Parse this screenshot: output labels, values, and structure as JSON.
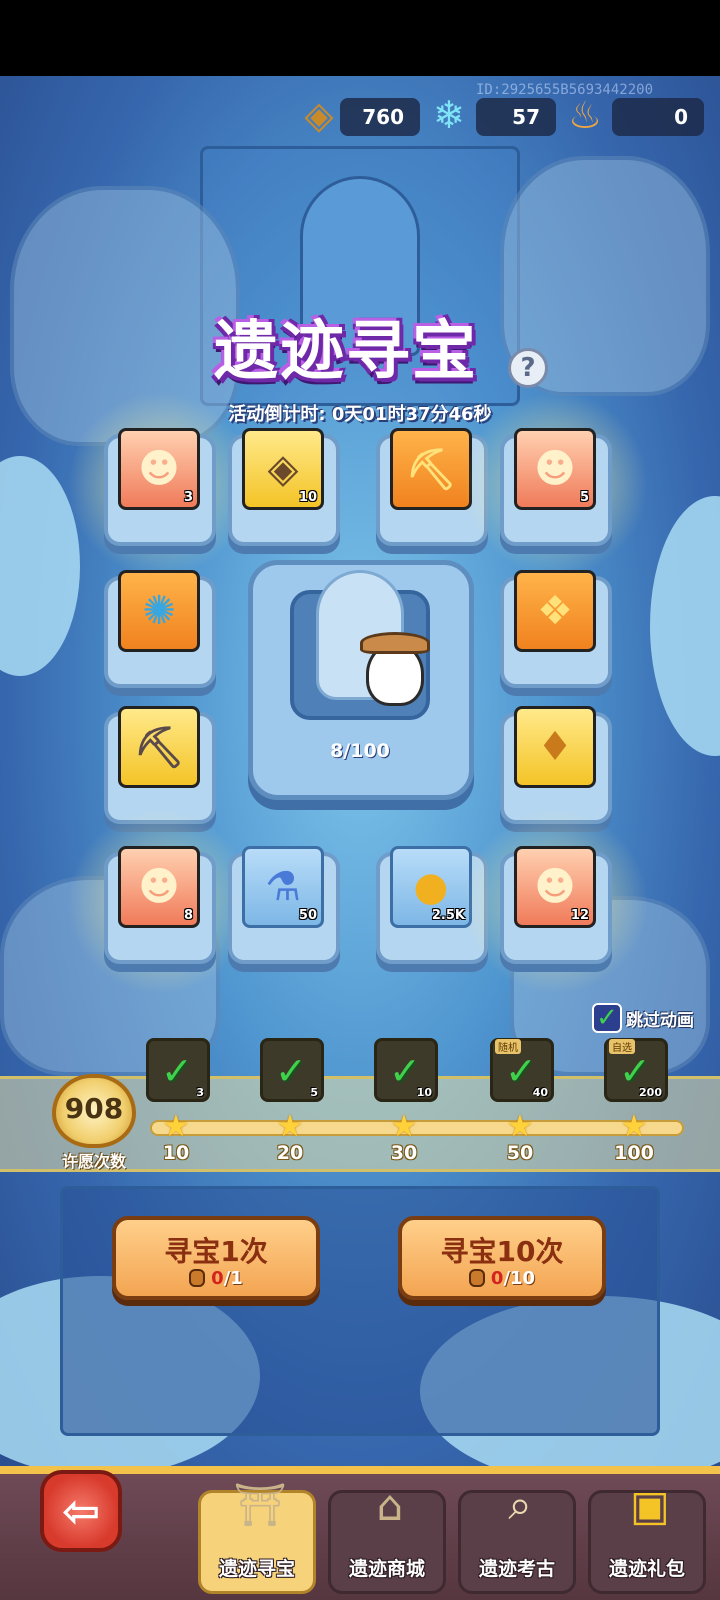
{
  "header": {
    "resources": [
      {
        "name": "rune-stone",
        "icon": "rune-stone-icon",
        "value": "760"
      },
      {
        "name": "crystal",
        "icon": "crystal-plus-icon",
        "value": "57"
      },
      {
        "name": "lantern",
        "icon": "lantern-icon",
        "value": "0"
      }
    ],
    "id_text": "ID:2925655B5693442200"
  },
  "event": {
    "title": "遗迹寻宝",
    "help_icon": "question-mark-icon",
    "countdown": "活动倒计时: 0天01时37分46秒"
  },
  "rewards": [
    {
      "name": "hero-shard",
      "style": "red",
      "icon": "hero-portrait-icon",
      "count": "3",
      "glow": true
    },
    {
      "name": "rune-stone",
      "style": "yellow",
      "icon": "rune-stone-icon",
      "count": "10",
      "glow": false
    },
    {
      "name": "pickaxe-gold",
      "style": "orange",
      "icon": "gold-pickaxe-icon",
      "count": "",
      "glow": false
    },
    {
      "name": "hero-shard",
      "style": "red",
      "icon": "hero-portrait-icon",
      "count": "5",
      "glow": true
    },
    {
      "name": "skill-scroll",
      "style": "orange",
      "icon": "swirl-scroll-icon",
      "count": "",
      "glow": false
    },
    {
      "name": "treasure-pile",
      "style": "orange",
      "icon": "treasure-pile-icon",
      "count": "",
      "glow": false
    },
    {
      "name": "pickaxe-iron",
      "style": "yellow",
      "icon": "iron-pickaxe-icon",
      "count": "",
      "glow": false
    },
    {
      "name": "gold-bag",
      "style": "yellow",
      "icon": "gold-bag-icon",
      "count": "",
      "glow": false
    },
    {
      "name": "hero-shard",
      "style": "red",
      "icon": "hero-portrait-icon",
      "count": "8",
      "glow": true
    },
    {
      "name": "potion",
      "style": "blue",
      "icon": "potion-bottle-icon",
      "count": "50",
      "glow": false
    },
    {
      "name": "coin",
      "style": "blue",
      "icon": "gold-coin-icon",
      "count": "2.5K",
      "glow": false
    },
    {
      "name": "hero-shard",
      "style": "red",
      "icon": "hero-portrait-icon",
      "count": "12",
      "glow": true
    }
  ],
  "center": {
    "progress_text": "8/100",
    "progress_fraction": 0.08
  },
  "skip_animation": {
    "label": "跳过动画",
    "checked": true
  },
  "milestones": {
    "wish_count": "908",
    "wish_label": "许愿次数",
    "items": [
      {
        "threshold": "10",
        "count": "3",
        "tag": "",
        "claimed": true
      },
      {
        "threshold": "20",
        "count": "5",
        "tag": "",
        "claimed": true
      },
      {
        "threshold": "30",
        "count": "10",
        "tag": "",
        "claimed": true
      },
      {
        "threshold": "50",
        "count": "40",
        "tag": "随机",
        "claimed": true
      },
      {
        "threshold": "100",
        "count": "200",
        "tag": "自选",
        "claimed": true
      }
    ]
  },
  "actions": {
    "single": {
      "label": "寻宝1次",
      "cost_have": "0",
      "cost_need": "/1"
    },
    "ten": {
      "label": "寻宝10次",
      "cost_have": "0",
      "cost_need": "/10"
    }
  },
  "nav": {
    "back_icon": "back-arrow-icon",
    "tabs": [
      {
        "label": "遗迹寻宝",
        "icon": "ruins-treasure-icon",
        "active": true
      },
      {
        "label": "遗迹商城",
        "icon": "ruins-shop-icon",
        "active": false
      },
      {
        "label": "遗迹考古",
        "icon": "archaeology-map-icon",
        "active": false
      },
      {
        "label": "遗迹礼包",
        "icon": "treasure-chest-icon",
        "active": false
      }
    ]
  },
  "colors": {
    "accent_gold": "#f3c24a",
    "button_orange": "#f3a552",
    "title_purple": "#6e28a8",
    "check_green": "#3fd04c"
  }
}
